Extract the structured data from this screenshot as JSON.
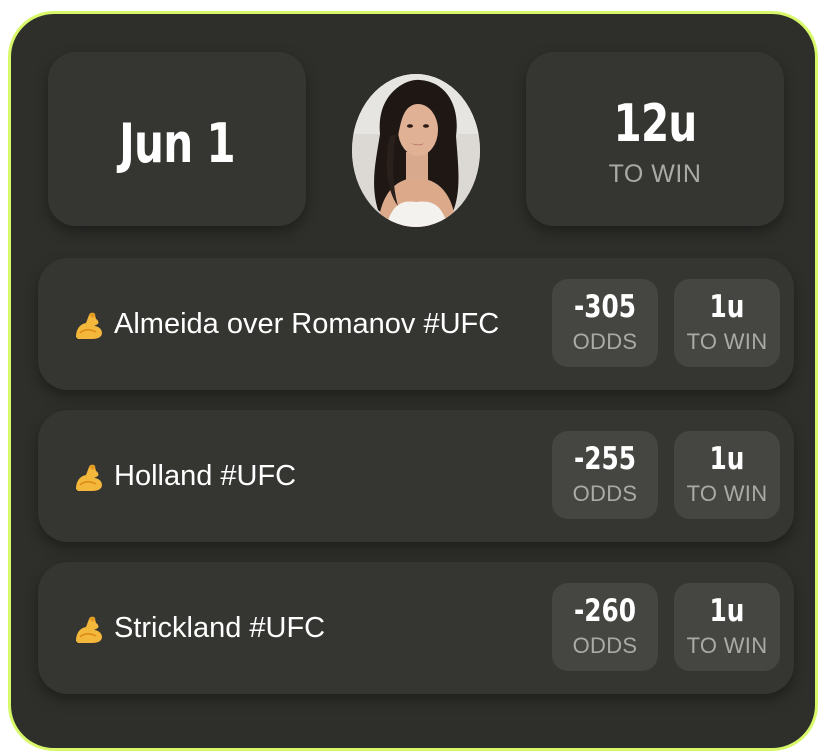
{
  "header": {
    "date": "Jun 1",
    "total_units": "12u",
    "total_label": "TO WIN"
  },
  "colors": {
    "accent_border": "#d8f86a",
    "card_background": "#2e2f2b",
    "tile_background": "#353631",
    "pill_background": "#454641"
  },
  "picks": [
    {
      "icon": "flexed-biceps-icon",
      "title": "Almeida over Romanov #UFC",
      "odds": "-305",
      "odds_label": "ODDS",
      "units": "1u",
      "units_label": "TO WIN"
    },
    {
      "icon": "flexed-biceps-icon",
      "title": "Holland #UFC",
      "odds": "-255",
      "odds_label": "ODDS",
      "units": "1u",
      "units_label": "TO WIN"
    },
    {
      "icon": "flexed-biceps-icon",
      "title": "Strickland #UFC",
      "odds": "-260",
      "odds_label": "ODDS",
      "units": "1u",
      "units_label": "TO WIN"
    }
  ]
}
